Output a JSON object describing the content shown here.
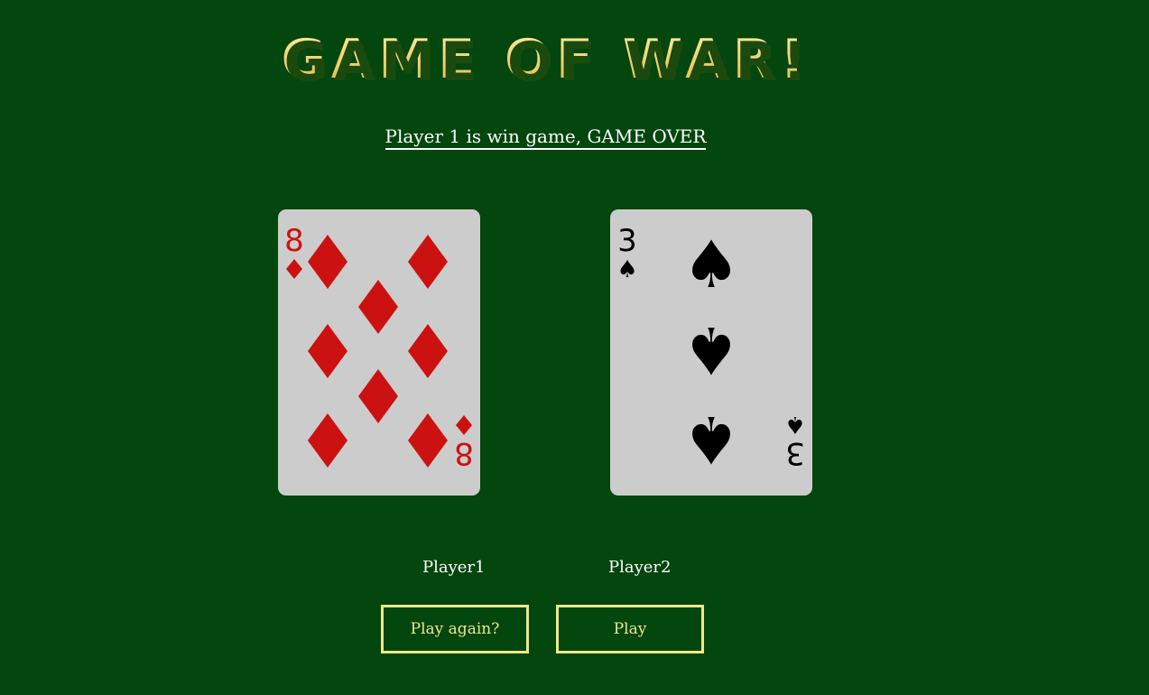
{
  "game": {
    "title": "GAME OF WAR!",
    "status": "Player 1 is win game, GAME OVER"
  },
  "cards": [
    {
      "player": "Player1",
      "rank": "8",
      "suit": "diamond",
      "suit_glyph": "♦",
      "color": "#cc1111"
    },
    {
      "player": "Player2",
      "rank": "3",
      "suit": "spade",
      "suit_glyph": "♠",
      "color": "#000000"
    }
  ],
  "buttons": {
    "play_again": "Play again?",
    "play": "Play"
  },
  "colors": {
    "background": "#03460e",
    "card": "#cccccc",
    "button_accent": "#f0e68c",
    "title_gold": "#f2d46a"
  }
}
